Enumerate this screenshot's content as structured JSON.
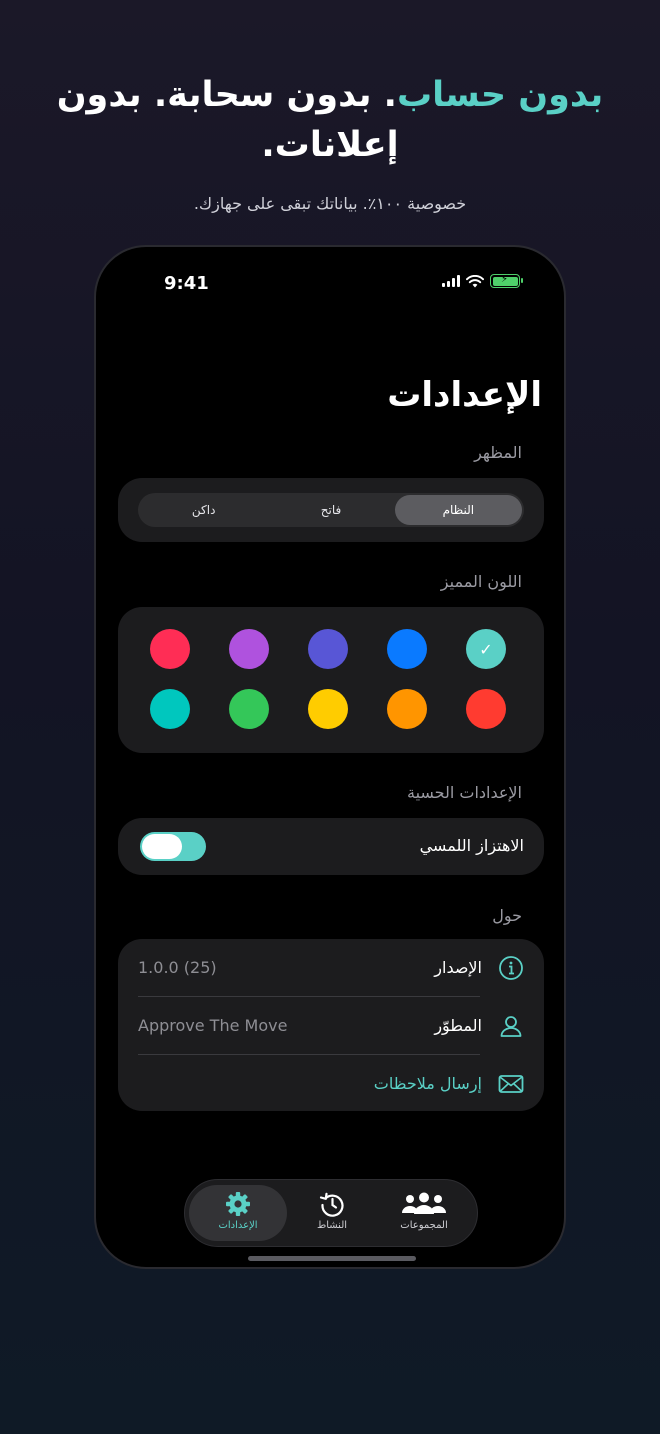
{
  "hero": {
    "headline_accent": "بدون حساب",
    "headline_rest": ". بدون سحابة. بدون إعلانات.",
    "subline": "خصوصية ١٠٠٪. بياناتك تبقى على جهازك."
  },
  "status": {
    "time": "9:41"
  },
  "screen": {
    "title": "الإعدادات"
  },
  "appearance": {
    "label": "المظهر",
    "options": [
      "النظام",
      "فاتح",
      "داكن"
    ],
    "selected": "النظام"
  },
  "accent": {
    "label": "اللون المميز",
    "colors": [
      "#5ad0c6",
      "#0a7aff",
      "#5856d6",
      "#af52de",
      "#ff2d55",
      "#ff3b30",
      "#ff9500",
      "#ffcc00",
      "#34c759",
      "#00c7be"
    ],
    "selected": "#5ad0c6"
  },
  "haptics": {
    "label": "الإعدادات الحسية",
    "row_label": "الاهتزاز اللمسي",
    "enabled": true
  },
  "about": {
    "label": "حول",
    "rows": [
      {
        "icon": "info-icon",
        "label": "الإصدار",
        "value": "1.0.0 (25)"
      },
      {
        "icon": "person-icon",
        "label": "المطوّر",
        "value": "Approve The Move"
      },
      {
        "icon": "envelope-icon",
        "label": "إرسال ملاحظات",
        "value": ""
      }
    ]
  },
  "tabbar": {
    "tabs": [
      {
        "icon": "gear-icon",
        "label": "الإعدادات"
      },
      {
        "icon": "clock-history-icon",
        "label": "النشاط"
      },
      {
        "icon": "people-icon",
        "label": "المجموعات"
      }
    ],
    "active": "الإعدادات"
  },
  "colors": {
    "accent": "#5ad0c6",
    "card": "#1c1c1e",
    "background": "#000000"
  }
}
